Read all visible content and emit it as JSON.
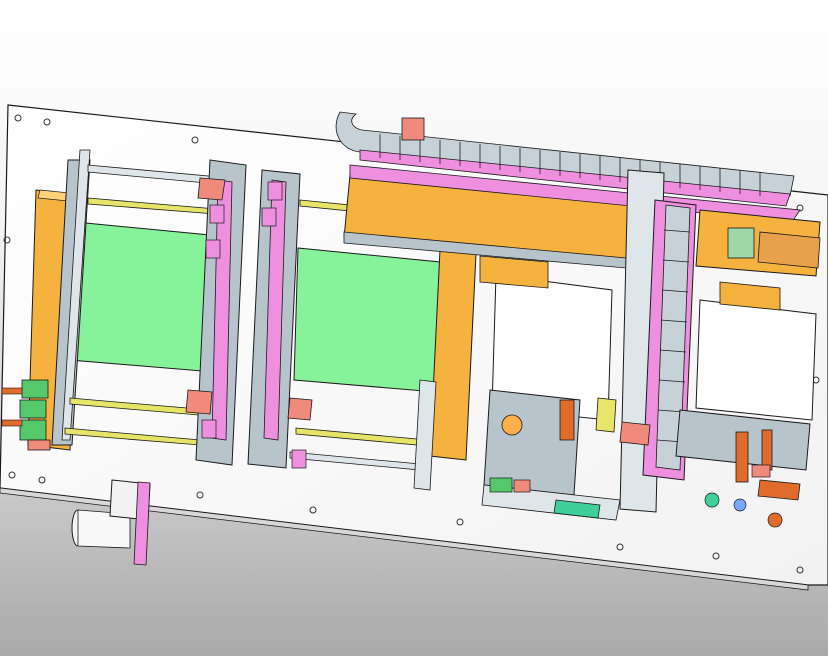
{
  "viewport": {
    "background_top": "#ffffff",
    "background_bottom": "#a9a9a9"
  },
  "colors": {
    "plate": "#ffffff",
    "outline": "#1a1a1a",
    "steel": "#b8c4cc",
    "orange": "#f6b23e",
    "green_panel": "#86f39a",
    "pink": "#ef8fe0",
    "salmon": "#f08a7a",
    "yellow_rod": "#e8e46a",
    "green_part": "#55c86b",
    "dark_orange": "#e06b2a",
    "teal": "#3fcf9a"
  },
  "assembly": {
    "base_plate": "base-plate",
    "cable_chains": [
      "horizontal-cable-chain",
      "vertical-cable-chain"
    ],
    "conveyors": [
      "left-conveyor-module",
      "middle-conveyor-module"
    ],
    "gantry": "gantry-beam",
    "boxes": [
      "center-box-module",
      "right-box-module"
    ],
    "loose_part": "detached-spool-part"
  }
}
